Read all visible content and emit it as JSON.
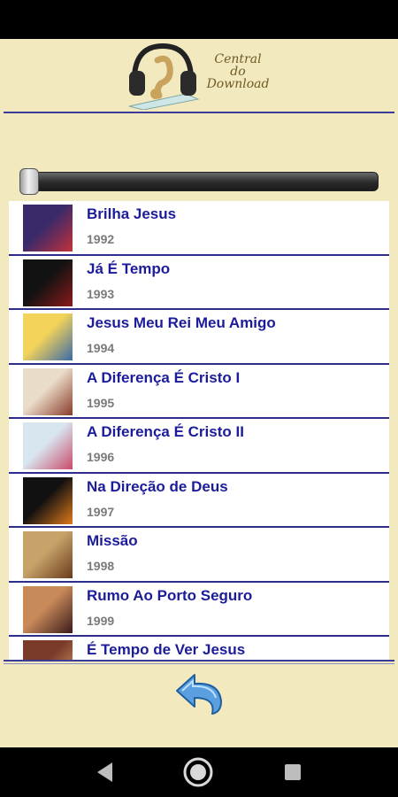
{
  "header": {
    "logo_text": [
      "Central",
      "do",
      "Download"
    ]
  },
  "slider": {
    "position": 0
  },
  "albums": [
    {
      "title": "Brilha Jesus",
      "year": "1992",
      "thumb": [
        "#3b2a6a",
        "#c2303a"
      ]
    },
    {
      "title": "Já É Tempo",
      "year": "1993",
      "thumb": [
        "#121212",
        "#8a1a1a"
      ]
    },
    {
      "title": "Jesus Meu Rei Meu Amigo",
      "year": "1994",
      "thumb": [
        "#f3d35a",
        "#3a6aa8"
      ]
    },
    {
      "title": "A Diferença É Cristo I",
      "year": "1995",
      "thumb": [
        "#e9dcc8",
        "#8a3a2a"
      ]
    },
    {
      "title": "A Diferença É Cristo II",
      "year": "1996",
      "thumb": [
        "#d8e6f0",
        "#c94a6a"
      ]
    },
    {
      "title": "Na Direção de Deus",
      "year": "1997",
      "thumb": [
        "#111111",
        "#e07a1a"
      ]
    },
    {
      "title": "Missão",
      "year": "1998",
      "thumb": [
        "#c7a36a",
        "#6a3a1a"
      ]
    },
    {
      "title": "Rumo Ao Porto Seguro",
      "year": "1999",
      "thumb": [
        "#c98a5a",
        "#3a1a1a"
      ]
    },
    {
      "title": "É Tempo de Ver Jesus",
      "year": "",
      "thumb": [
        "#7a3a2a",
        "#d8a06a"
      ]
    }
  ]
}
